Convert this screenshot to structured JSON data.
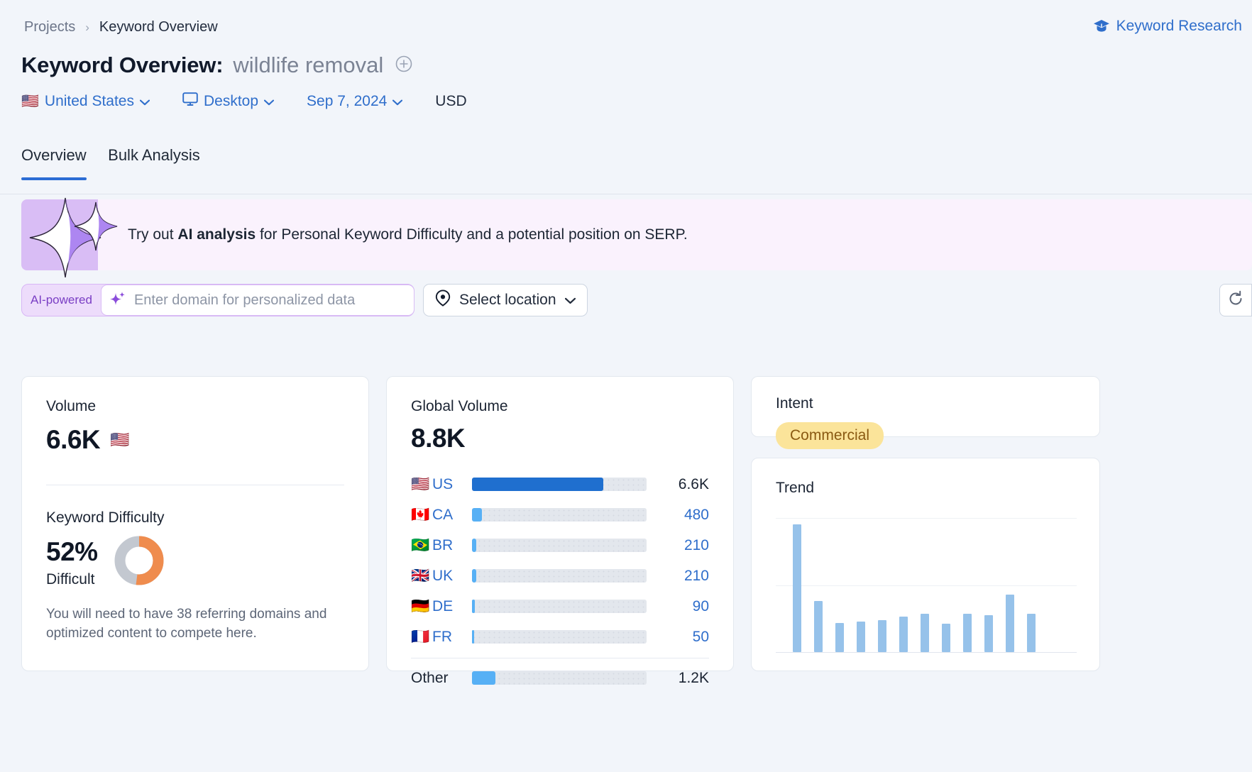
{
  "breadcrumb": {
    "root": "Projects",
    "separator": "›",
    "current": "Keyword Overview"
  },
  "header": {
    "research_link": "Keyword Research",
    "title_prefix": "Keyword Overview:",
    "keyword": "wildlife removal",
    "add_icon": "plus-circle-icon"
  },
  "filters": {
    "country": "United States",
    "country_flag": "🇺🇸",
    "device": "Desktop",
    "date": "Sep 7, 2024",
    "currency": "USD"
  },
  "tabs": [
    {
      "label": "Overview",
      "active": true
    },
    {
      "label": "Bulk Analysis",
      "active": false
    }
  ],
  "ai_banner": {
    "text_before": "Try out ",
    "text_bold": "AI analysis",
    "text_after": " for Personal Keyword Difficulty and a potential position on SERP.",
    "accent_color": "#d9bdf5",
    "background_color": "#faf2fd"
  },
  "ai_row": {
    "powered_label": "AI-powered",
    "domain_placeholder": "Enter domain for personalized data",
    "domain_value": "",
    "location_label": "Select location",
    "refresh_icon": "refresh-icon"
  },
  "volume_card": {
    "label": "Volume",
    "value": "6.6K",
    "flag": "🇺🇸",
    "kd_label": "Keyword Difficulty",
    "kd_value": "52%",
    "kd_word": "Difficult",
    "kd_percent": 52,
    "kd_note": "You will need to have 38 referring domains and optimized content to compete here.",
    "kd_ring_color": "#ef8c4e",
    "kd_track_color": "#c3c8d0"
  },
  "global_card": {
    "label": "Global Volume",
    "value": "8.8K",
    "rows": [
      {
        "flag": "🇺🇸",
        "code": "US",
        "value": "6.6K",
        "pct": 75,
        "color": "#1f6fcf",
        "primary": true
      },
      {
        "flag": "🇨🇦",
        "code": "CA",
        "value": "480",
        "pct": 5.5,
        "color": "#57b0f5",
        "primary": false
      },
      {
        "flag": "🇧🇷",
        "code": "BR",
        "value": "210",
        "pct": 2.4,
        "color": "#57b0f5",
        "primary": false
      },
      {
        "flag": "🇬🇧",
        "code": "UK",
        "value": "210",
        "pct": 2.4,
        "color": "#57b0f5",
        "primary": false
      },
      {
        "flag": "🇩🇪",
        "code": "DE",
        "value": "90",
        "pct": 1.6,
        "color": "#57b0f5",
        "primary": false
      },
      {
        "flag": "🇫🇷",
        "code": "FR",
        "value": "50",
        "pct": 1.4,
        "color": "#57b0f5",
        "primary": false
      }
    ],
    "other": {
      "code": "Other",
      "value": "1.2K",
      "pct": 13.5,
      "color": "#57b0f5"
    }
  },
  "intent_card": {
    "label": "Intent",
    "badge": "Commercial",
    "badge_bg": "#fbe49a",
    "badge_fg": "#8a5a12"
  },
  "trend_card": {
    "label": "Trend"
  },
  "chart_data": {
    "type": "bar",
    "title": "Trend",
    "categories": [
      "1",
      "2",
      "3",
      "4",
      "5",
      "6",
      "7",
      "8",
      "9",
      "10",
      "11",
      "12"
    ],
    "values": [
      100,
      40,
      23,
      24,
      25,
      28,
      30,
      22,
      30,
      29,
      45,
      30
    ],
    "xlabel": "",
    "ylabel": "",
    "ylim": [
      0,
      105
    ],
    "grid": true,
    "bar_color": "#96c2ea",
    "legend": "none"
  }
}
